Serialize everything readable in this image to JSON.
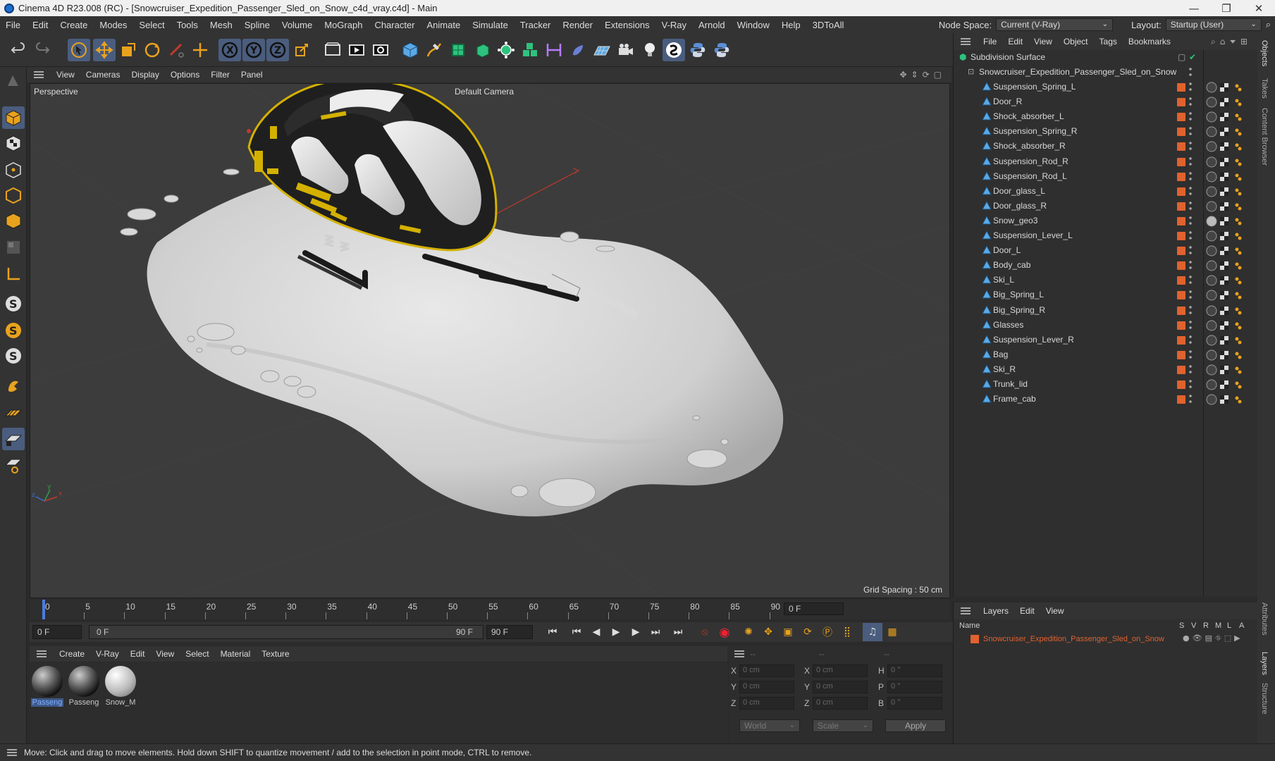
{
  "window": {
    "title": "Cinema 4D R23.008 (RC) - [Snowcruiser_Expedition_Passenger_Sled_on_Snow_c4d_vray.c4d] - Main",
    "min": "—",
    "max": "❐",
    "close": "✕"
  },
  "menu": [
    "File",
    "Edit",
    "Create",
    "Modes",
    "Select",
    "Tools",
    "Mesh",
    "Spline",
    "Volume",
    "MoGraph",
    "Character",
    "Animate",
    "Simulate",
    "Tracker",
    "Render",
    "Extensions",
    "V-Ray",
    "Arnold",
    "Window",
    "Help",
    "3DToAll"
  ],
  "node_space": {
    "label": "Node Space:",
    "value": "Current (V-Ray)"
  },
  "layout": {
    "label": "Layout:",
    "value": "Startup (User)"
  },
  "viewport_menu": [
    "View",
    "Cameras",
    "Display",
    "Options",
    "Filter",
    "Panel"
  ],
  "viewport": {
    "projection": "Perspective",
    "camera": "Default Camera",
    "grid_spacing": "Grid Spacing : 50 cm"
  },
  "timeline": {
    "ticks": [
      "0",
      "5",
      "10",
      "15",
      "20",
      "25",
      "30",
      "35",
      "40",
      "45",
      "50",
      "55",
      "60",
      "65",
      "70",
      "75",
      "80",
      "85",
      "90"
    ],
    "current": "0 F"
  },
  "frames": {
    "start": "0 F",
    "range_start": "0 F",
    "range_end": "90 F",
    "end": "90 F"
  },
  "material_menu": [
    "Create",
    "V-Ray",
    "Edit",
    "View",
    "Select",
    "Material",
    "Texture"
  ],
  "materials": [
    {
      "name": "Passeng",
      "selected": true
    },
    {
      "name": "Passeng",
      "selected": false
    },
    {
      "name": "Snow_M",
      "selected": false
    }
  ],
  "coords": {
    "header": [
      "--",
      "--",
      "--"
    ],
    "rows": [
      {
        "a": "X",
        "av": "0 cm",
        "b": "X",
        "bv": "0 cm",
        "c": "H",
        "cv": "0 °"
      },
      {
        "a": "Y",
        "av": "0 cm",
        "b": "Y",
        "bv": "0 cm",
        "c": "P",
        "cv": "0 °"
      },
      {
        "a": "Z",
        "av": "0 cm",
        "b": "Z",
        "bv": "0 cm",
        "c": "B",
        "cv": "0 °"
      }
    ],
    "space": "World",
    "mode": "Scale",
    "apply": "Apply"
  },
  "status": "Move: Click and drag to move elements. Hold down SHIFT to quantize movement / add to the selection in point mode, CTRL to remove.",
  "object_menu": [
    "File",
    "Edit",
    "View",
    "Object",
    "Tags",
    "Bookmarks"
  ],
  "objects": {
    "root": "Subdivision Surface",
    "group": "Snowcruiser_Expedition_Passenger_Sled_on_Snow",
    "children": [
      "Suspension_Spring_L",
      "Door_R",
      "Shock_absorber_L",
      "Suspension_Spring_R",
      "Shock_absorber_R",
      "Suspension_Rod_R",
      "Suspension_Rod_L",
      "Door_glass_L",
      "Door_glass_R",
      "Snow_geo3",
      "Suspension_Lever_L",
      "Door_L",
      "Body_cab",
      "Ski_L",
      "Big_Spring_L",
      "Big_Spring_R",
      "Glasses",
      "Suspension_Lever_R",
      "Bag",
      "Ski_R",
      "Trunk_lid",
      "Frame_cab"
    ]
  },
  "layer_menu": [
    "Layers",
    "Edit",
    "View"
  ],
  "layer_cols": {
    "name": "Name",
    "flags": [
      "S",
      "V",
      "R",
      "M",
      "L",
      "A"
    ]
  },
  "layers": [
    {
      "name": "Snowcruiser_Expedition_Passenger_Sled_on_Snow"
    }
  ],
  "right_tabs": [
    "Objects",
    "Takes",
    "Content Browser",
    "Attributes",
    "Layers",
    "Structure"
  ],
  "colors": {
    "accent": "#4a5d7e",
    "layer_orange": "#e0622e",
    "selection_blue": "#7fb0ff"
  }
}
